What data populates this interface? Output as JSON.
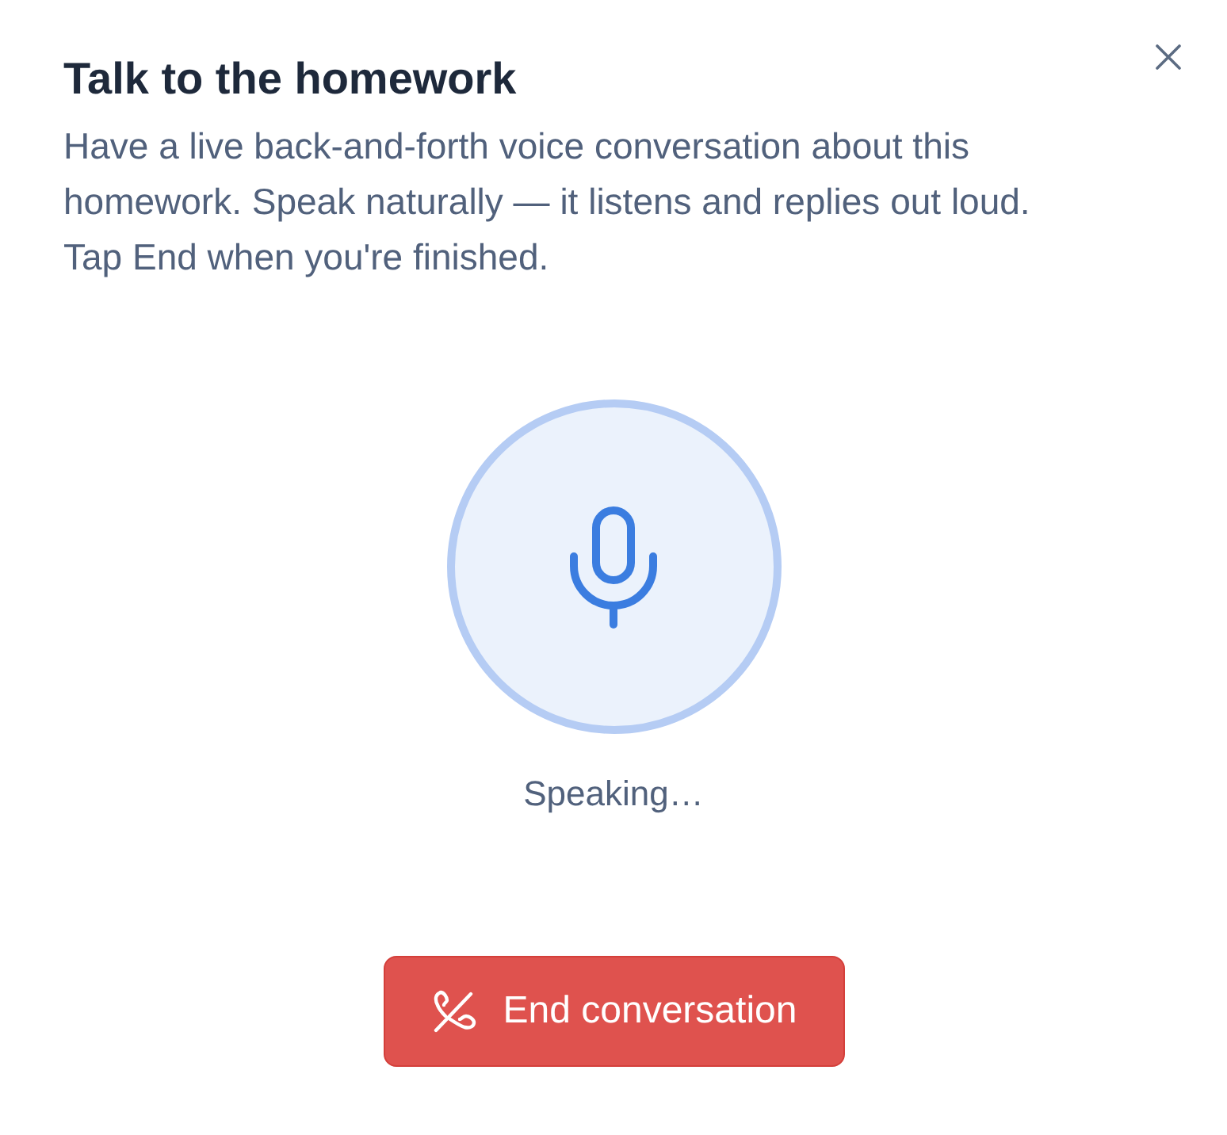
{
  "dialog": {
    "title": "Talk to the homework",
    "description": "Have a live back-and-forth voice conversation about this homework. Speak naturally — it listens and replies out loud. Tap End when you're finished."
  },
  "voice": {
    "status": "Speaking…"
  },
  "buttons": [
    {
      "label": "End conversation",
      "kind": "danger"
    }
  ]
}
